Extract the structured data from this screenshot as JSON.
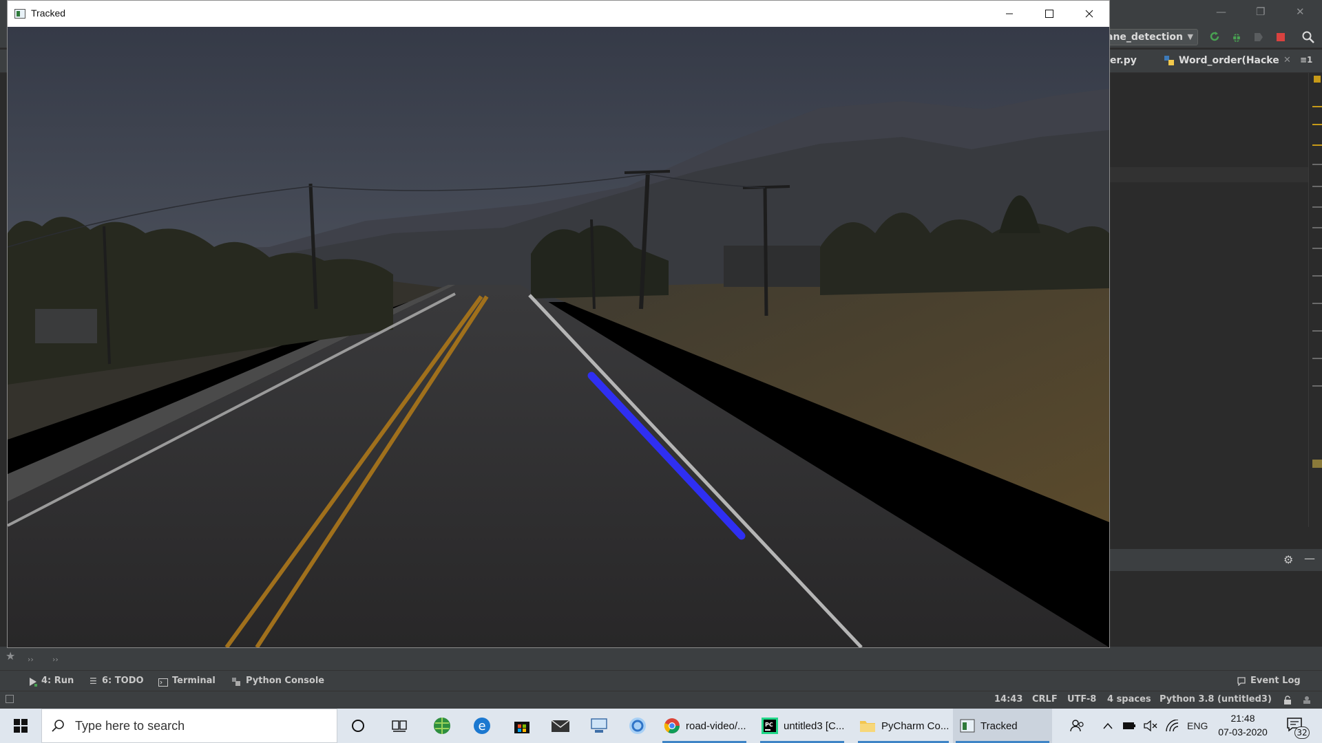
{
  "ide": {
    "run_config": "ane_detection",
    "tabs": [
      "er.py",
      "Word_order(Hacke"
    ],
    "tab_menu": "≡1",
    "tool_tabs": [
      {
        "label": "4: Run",
        "icon": "run-icon"
      },
      {
        "label": "6: TODO",
        "icon": "todo-icon"
      },
      {
        "label": "Terminal",
        "icon": "terminal-icon"
      },
      {
        "label": "Python Console",
        "icon": "python-console-icon"
      }
    ],
    "event_log": "Event Log",
    "status": {
      "position": "14:43",
      "line_sep": "CRLF",
      "encoding": "UTF-8",
      "indent": "4 spaces",
      "interpreter": "Python 3.8 (untitled3)"
    },
    "side_chevrons": [
      "››",
      "››"
    ]
  },
  "tracked_window": {
    "title": "Tracked",
    "controls": [
      "minimize",
      "maximize",
      "close"
    ]
  },
  "video_frame": {
    "description_colors": {
      "sky": "#3b3f4a",
      "road": "#2e2d2e",
      "lane_yellow": "#b37a1c",
      "lane_white": "#bdbdbd",
      "detected_lane": "#2a2cf0"
    }
  },
  "taskbar": {
    "search_placeholder": "Type here to search",
    "apps": [
      {
        "label": "road-video/...",
        "icon": "chrome-icon"
      },
      {
        "label": "untitled3 [C...",
        "icon": "pycharm-icon"
      },
      {
        "label": "PyCharm Co...",
        "icon": "folder-icon"
      },
      {
        "label": "Tracked",
        "icon": "tracked-app-icon"
      }
    ],
    "language": "ENG",
    "time": "21:48",
    "date": "07-03-2020",
    "notification_count": "32"
  }
}
